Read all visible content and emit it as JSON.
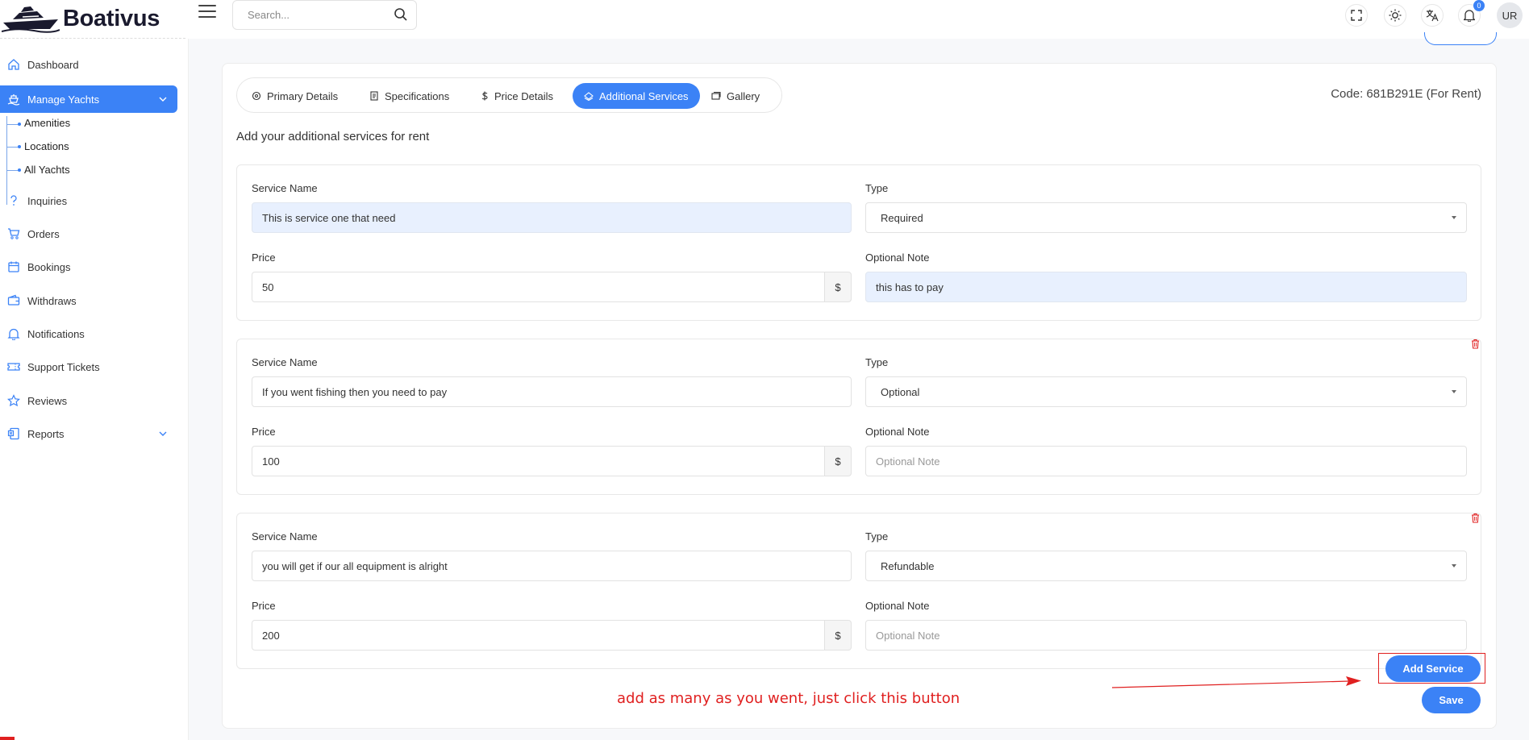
{
  "app": {
    "logo_text": "Boativus"
  },
  "header": {
    "search_placeholder": "Search...",
    "notification_count": "0",
    "avatar_initials": "UR"
  },
  "sidebar": {
    "items": [
      {
        "label": "Dashboard",
        "icon": "home-icon"
      },
      {
        "label": "Manage Yachts",
        "icon": "yacht-icon",
        "active": true
      },
      {
        "label": "Inquiries",
        "icon": "question-icon"
      },
      {
        "label": "Orders",
        "icon": "cart-icon"
      },
      {
        "label": "Bookings",
        "icon": "calendar-icon"
      },
      {
        "label": "Withdraws",
        "icon": "wallet-icon"
      },
      {
        "label": "Notifications",
        "icon": "bell-icon"
      },
      {
        "label": "Support Tickets",
        "icon": "ticket-icon"
      },
      {
        "label": "Reviews",
        "icon": "star-icon"
      },
      {
        "label": "Reports",
        "icon": "report-icon"
      }
    ],
    "sub_items": [
      "Amenities",
      "Locations",
      "All Yachts"
    ]
  },
  "tabs": [
    {
      "label": "Primary Details",
      "icon": "anchor-icon"
    },
    {
      "label": "Specifications",
      "icon": "document-icon"
    },
    {
      "label": "Price Details",
      "icon": "dollar-icon"
    },
    {
      "label": "Additional Services",
      "icon": "service-icon",
      "active": true
    },
    {
      "label": "Gallery",
      "icon": "gallery-icon"
    }
  ],
  "code_label": "Code: 681B291E (For Rent)",
  "intro": "Add your additional services for rent",
  "labels": {
    "service_name": "Service Name",
    "type": "Type",
    "price": "Price",
    "optional_note": "Optional Note",
    "currency": "$"
  },
  "services": [
    {
      "name": "This is service one that need",
      "type": "Required",
      "price": "50",
      "note": "this has to pay",
      "note_placeholder": "Optional Note"
    },
    {
      "name": "If you went fishing then you need to pay",
      "type": "Optional",
      "price": "100",
      "note": "",
      "note_placeholder": "Optional Note"
    },
    {
      "name": "you will get if our all equipment is alright",
      "type": "Refundable",
      "price": "200",
      "note": "",
      "note_placeholder": "Optional Note"
    }
  ],
  "buttons": {
    "add_service": "Add Service",
    "save": "Save"
  },
  "annotation_text": "add as many as you went, just click this button",
  "colors": {
    "accent": "#3b82f6",
    "annotation": "#e02020",
    "filled_input": "#e8f0fe"
  }
}
